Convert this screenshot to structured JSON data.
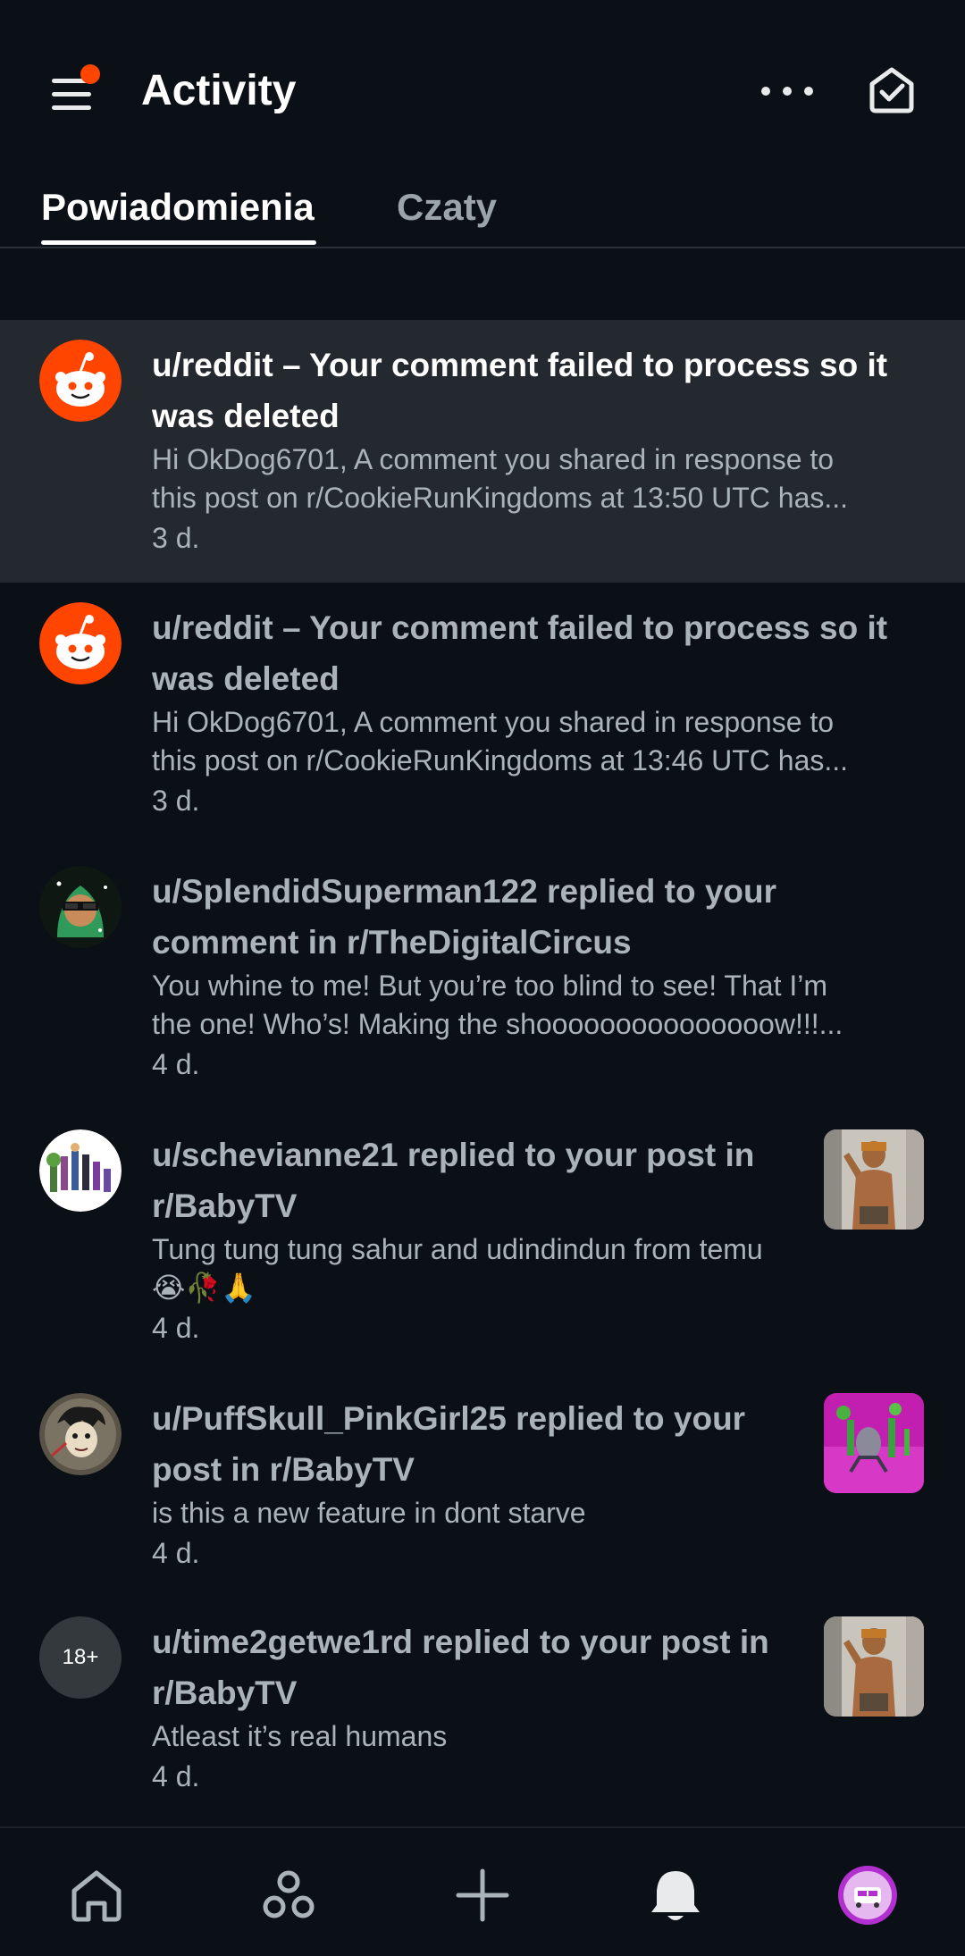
{
  "header": {
    "title": "Activity",
    "menu_icon": "hamburger-menu-icon",
    "more_icon": "more-horizontal-icon",
    "mark_read_icon": "mark-all-read-icon"
  },
  "tabs": [
    {
      "label": "Powiadomienia",
      "active": true
    },
    {
      "label": "Czaty",
      "active": false
    }
  ],
  "notifications": [
    {
      "title_line1": "u/reddit – Your comment failed to process so it",
      "title_line2": "was deleted",
      "body_line1": "Hi OkDog6701, A comment you shared in response to",
      "body_line2": "this post on r/CookieRunKingdoms at 13:50 UTC has...",
      "time": "3 d.",
      "avatar": "reddit-snoo-icon",
      "unread": true
    },
    {
      "title_line1": "u/reddit – Your comment failed to process so it",
      "title_line2": "was deleted",
      "body_line1": "Hi OkDog6701, A comment you shared in response to",
      "body_line2": "this post on r/CookieRunKingdoms at 13:46 UTC has...",
      "time": "3 d.",
      "avatar": "reddit-snoo-icon",
      "unread": false
    },
    {
      "title_line1": "u/SplendidSuperman122 replied to your",
      "title_line2": "comment in r/TheDigitalCircus",
      "body_line1": "You whine to me!  But you’re too blind to see!  That I’m",
      "body_line2": "the one!  Who’s!  Making the shooooooooooooooow!!!...",
      "time": "4 d.",
      "avatar": "user-avatar-green-hood",
      "unread": false
    },
    {
      "title_line1": "u/schevianne21 replied to your post in",
      "title_line2": "r/BabyTV",
      "body_line1": "Tung tung tung sahur and udindindun from temu",
      "body_line2": "😭🥀🙏",
      "time": "4 d.",
      "avatar": "user-avatar-characters",
      "thumbnail": "post-thumbnail-person",
      "unread": false
    },
    {
      "title_line1": "u/PuffSkull_PinkGirl25 replied to your",
      "title_line2": "post in r/BabyTV",
      "body_line1": "is this a new feature in dont starve",
      "time": "4 d.",
      "avatar": "user-avatar-dont-starve",
      "thumbnail": "post-thumbnail-pink",
      "unread": false
    },
    {
      "title_line1": "u/time2getwe1rd replied to your post in",
      "title_line2": "r/BabyTV",
      "body_line1": "Atleast it’s real humans",
      "time": "4 d.",
      "avatar_text": "18+",
      "thumbnail": "post-thumbnail-person",
      "unread": false
    }
  ],
  "bottom_nav": [
    {
      "name": "home",
      "icon": "home-icon"
    },
    {
      "name": "communities",
      "icon": "communities-icon"
    },
    {
      "name": "create",
      "icon": "plus-icon"
    },
    {
      "name": "inbox",
      "icon": "bell-icon",
      "active": true
    },
    {
      "name": "profile",
      "icon": "profile-avatar-icon"
    }
  ],
  "colors": {
    "background": "#0b1016",
    "highlight": "#23292e",
    "accent": "#ff4500",
    "muted_text": "#aab3ba"
  }
}
